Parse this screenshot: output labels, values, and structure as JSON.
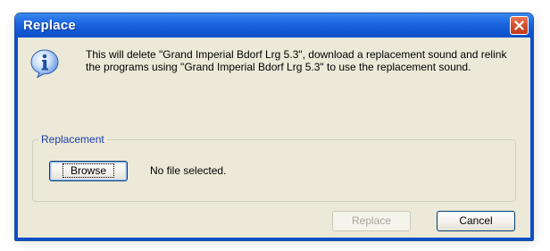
{
  "window": {
    "title": "Replace",
    "close_symbol": "close-icon"
  },
  "message": {
    "icon": "info-icon",
    "text": "This will delete \"Grand Imperial Bdorf Lrg 5.3\", download a replacement sound and relink the programs using \"Grand Imperial Bdorf Lrg 5.3\" to use the replacement sound."
  },
  "replacement_group": {
    "legend": "Replacement",
    "browse_label": "Browse",
    "file_status": "No file selected."
  },
  "footer": {
    "replace_label": "Replace",
    "replace_enabled": false,
    "cancel_label": "Cancel"
  },
  "colors": {
    "title_bar": "#0c4fc7",
    "dialog_face": "#ece9d8",
    "legend_text": "#1a3ea8",
    "close_button": "#d9512f",
    "disabled_text": "#a7a69c"
  }
}
